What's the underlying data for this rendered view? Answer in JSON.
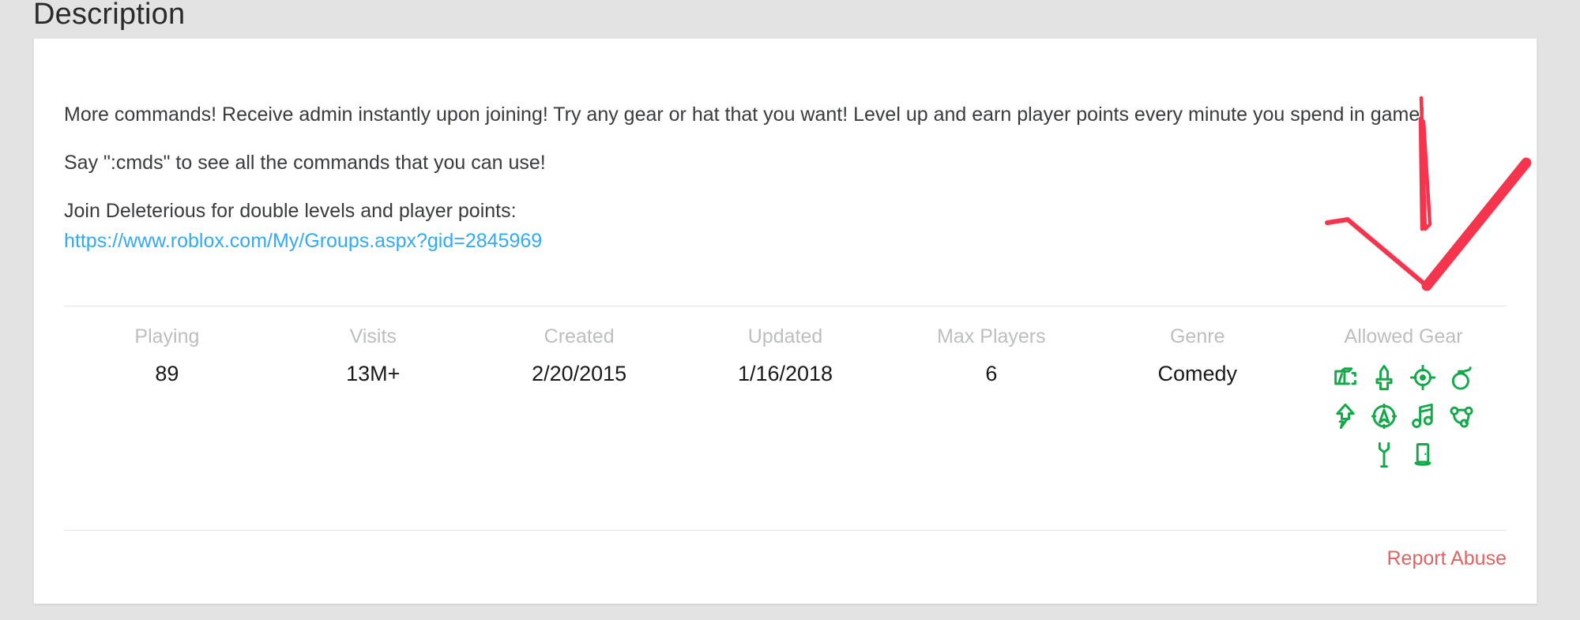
{
  "page": {
    "title": "Description",
    "background_color": "#e3e3e3",
    "card_background": "#ffffff"
  },
  "description": {
    "paragraphs": [
      "More commands! Receive admin instantly upon joining! Try any gear or hat that you want! Level up and earn player points every minute you spend in game!",
      "Say \":cmds\" to see all the commands that you can use!",
      "Join Deleterious for double levels and player points:"
    ],
    "link_text": "https://www.roblox.com/My/Groups.aspx?gid=2845969",
    "link_color": "#34aaf2"
  },
  "stats": [
    {
      "label": "Playing",
      "value": "89"
    },
    {
      "label": "Visits",
      "value": "13M+"
    },
    {
      "label": "Created",
      "value": "2/20/2015"
    },
    {
      "label": "Updated",
      "value": "1/16/2018"
    },
    {
      "label": "Max Players",
      "value": "6"
    },
    {
      "label": "Genre",
      "value": "Comedy"
    }
  ],
  "allowed_gear": {
    "label": "Allowed Gear",
    "color": "#13a84a",
    "icons": [
      "building-tools-icon",
      "melee-weapon-icon",
      "ranged-weapon-icon",
      "explosive-icon",
      "power-up-icon",
      "navigation-icon",
      "musical-instrument-icon",
      "social-item-icon",
      "transport-icon",
      "teleport-icon"
    ]
  },
  "footer": {
    "report_abuse_label": "Report Abuse",
    "report_abuse_color": "#e06464"
  },
  "annotation": {
    "type": "handdrawn-checkmark",
    "color": "#f4354d"
  }
}
